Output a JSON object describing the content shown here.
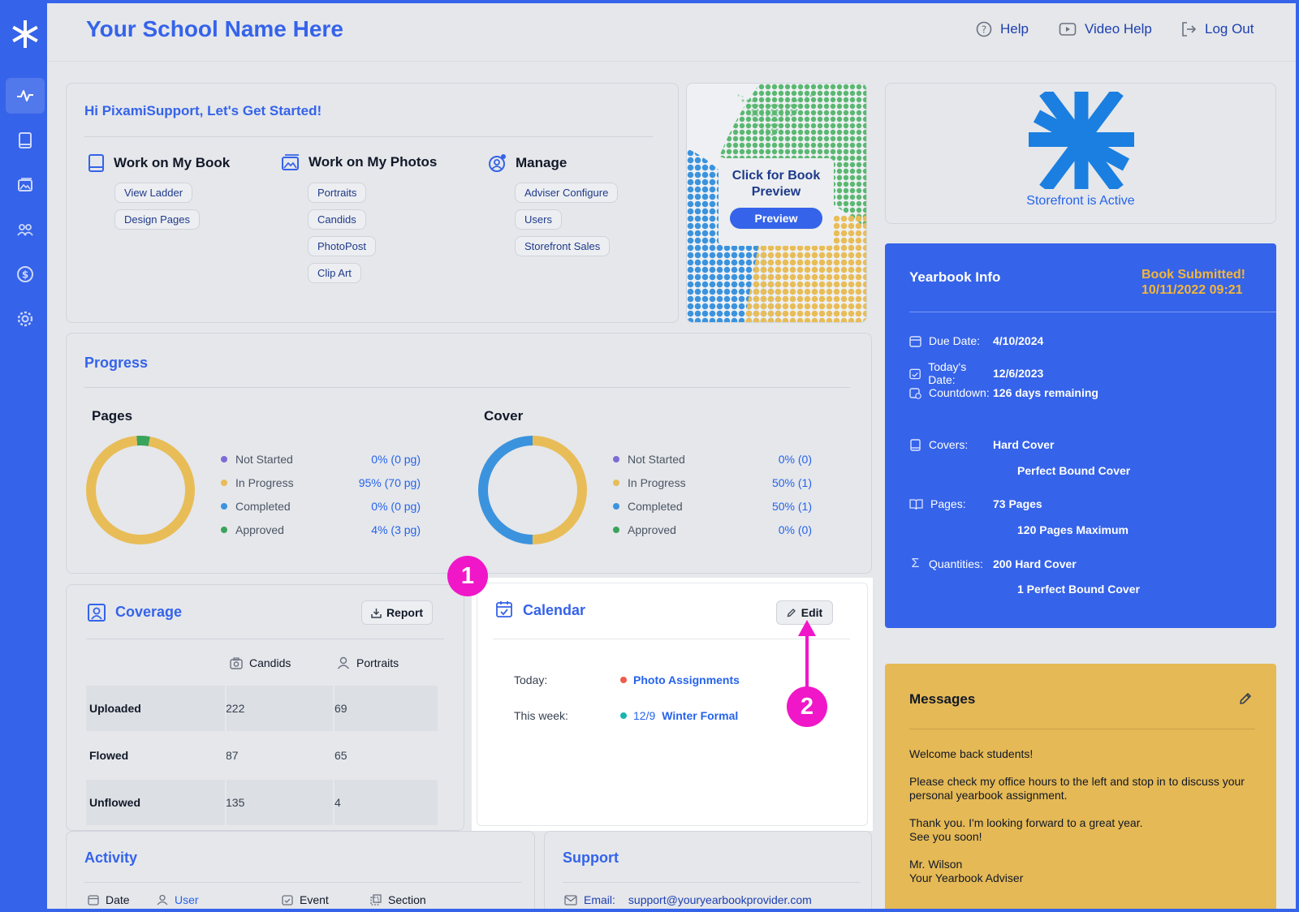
{
  "header": {
    "school_name": "Your School Name Here",
    "help": "Help",
    "video_help": "Video Help",
    "log_out": "Log Out"
  },
  "sidebar": {
    "items": [
      {
        "icon": "activity-icon",
        "active": true
      },
      {
        "icon": "book-icon"
      },
      {
        "icon": "photos-icon"
      },
      {
        "icon": "users-icon"
      },
      {
        "icon": "dollar-icon"
      },
      {
        "icon": "gear-icon"
      }
    ]
  },
  "get_started": {
    "greeting": "Hi PixamiSupport, Let's Get Started!",
    "book": {
      "title": "Work on My Book",
      "links": [
        "View Ladder",
        "Design Pages"
      ]
    },
    "photos": {
      "title": "Work on My Photos",
      "links": [
        "Portraits",
        "Candids",
        "PhotoPost",
        "Clip Art"
      ]
    },
    "manage": {
      "title": "Manage",
      "links": [
        "Adviser Configure",
        "Users",
        "Storefront Sales"
      ]
    }
  },
  "preview": {
    "text_line1": "Click for Book",
    "text_line2": "Preview",
    "button": "Preview"
  },
  "storefront": {
    "label": "Storefront is Active"
  },
  "yearbook_info": {
    "title": "Yearbook Info",
    "status_line1": "Book Submitted!",
    "status_line2": "10/11/2022 09:21",
    "due_date_label": "Due Date:",
    "due_date": "4/10/2024",
    "today_label": "Today's Date:",
    "today": "12/6/2023",
    "countdown_label": "Countdown:",
    "countdown": "126 days remaining",
    "covers_label": "Covers:",
    "covers": [
      "Hard Cover",
      "Perfect Bound Cover"
    ],
    "pages_label": "Pages:",
    "pages": [
      "73 Pages",
      "120 Pages Maximum"
    ],
    "quantities_label": "Quantities:",
    "quantities": [
      "200 Hard Cover",
      "1 Perfect Bound Cover"
    ]
  },
  "messages": {
    "title": "Messages",
    "lines": [
      "Welcome back students!",
      "Please check my office hours to the left and stop in to discuss your personal yearbook assignment.",
      "Thank you. I'm looking forward to a great year.",
      "See you soon!",
      "Mr. Wilson",
      "Your Yearbook Adviser"
    ]
  },
  "progress": {
    "title": "Progress",
    "pages": {
      "title": "Pages",
      "legend": [
        {
          "label": "Not Started",
          "value": "0% (0 pg)",
          "color": "#7c6cd6",
          "pct": 0
        },
        {
          "label": "In Progress",
          "value": "95% (70 pg)",
          "color": "#e8bd58",
          "pct": 95
        },
        {
          "label": "Completed",
          "value": "0% (0 pg)",
          "color": "#3b93de",
          "pct": 0
        },
        {
          "label": "Approved",
          "value": "4% (3 pg)",
          "color": "#3aa35b",
          "pct": 4
        }
      ]
    },
    "cover": {
      "title": "Cover",
      "legend": [
        {
          "label": "Not Started",
          "value": "0% (0)",
          "color": "#7c6cd6",
          "pct": 0
        },
        {
          "label": "In Progress",
          "value": "50% (1)",
          "color": "#e8bd58",
          "pct": 50
        },
        {
          "label": "Completed",
          "value": "50% (1)",
          "color": "#3b93de",
          "pct": 50
        },
        {
          "label": "Approved",
          "value": "0% (0)",
          "color": "#3aa35b",
          "pct": 0
        }
      ]
    }
  },
  "coverage": {
    "title": "Coverage",
    "report_button": "Report",
    "columns": [
      "Candids",
      "Portraits"
    ],
    "rows": [
      {
        "label": "Uploaded",
        "candids": "222",
        "portraits": "69"
      },
      {
        "label": "Flowed",
        "candids": "87",
        "portraits": "65"
      },
      {
        "label": "Unflowed",
        "candids": "135",
        "portraits": "4"
      }
    ]
  },
  "calendar": {
    "title": "Calendar",
    "edit_button": "Edit",
    "today_label": "Today:",
    "today_event": "Photo Assignments",
    "today_color": "#ef5b4c",
    "week_label": "This week:",
    "week_date": "12/9",
    "week_event": "Winter Formal",
    "week_color": "#17b5b0"
  },
  "annotations": {
    "badge1": "1",
    "badge2": "2"
  },
  "activity": {
    "title": "Activity",
    "columns": [
      "Date",
      "User",
      "Event",
      "Section"
    ]
  },
  "support": {
    "title": "Support",
    "email_label": "Email:",
    "email": "support@youryearbookprovider.com"
  }
}
